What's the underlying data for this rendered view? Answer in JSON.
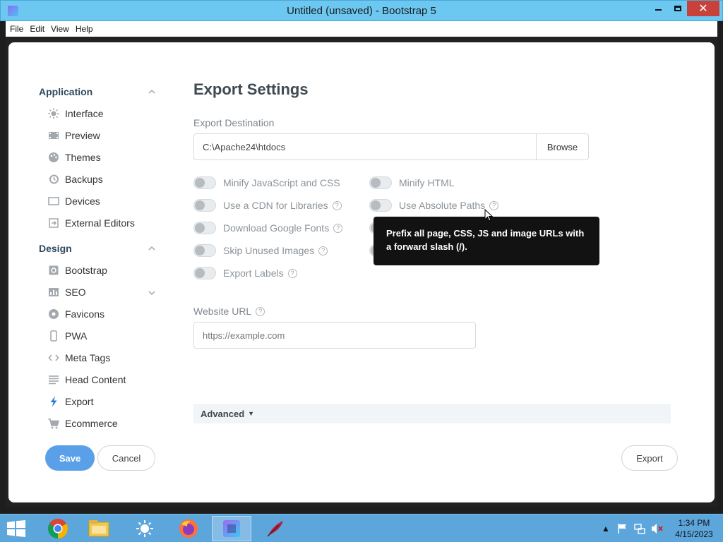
{
  "window": {
    "title": "Untitled (unsaved) - Bootstrap 5"
  },
  "menu": [
    "File",
    "Edit",
    "View",
    "Help"
  ],
  "sidebar": {
    "application": {
      "label": "Application",
      "items": [
        {
          "label": "Interface",
          "icon": "sun-icon"
        },
        {
          "label": "Preview",
          "icon": "film-icon"
        },
        {
          "label": "Themes",
          "icon": "palette-icon"
        },
        {
          "label": "Backups",
          "icon": "history-icon"
        },
        {
          "label": "Devices",
          "icon": "monitor-icon"
        },
        {
          "label": "External Editors",
          "icon": "external-icon"
        }
      ]
    },
    "design": {
      "label": "Design",
      "items": [
        {
          "label": "Bootstrap",
          "icon": "gear-icon"
        },
        {
          "label": "SEO",
          "icon": "chart-icon"
        },
        {
          "label": "Favicons",
          "icon": "circle-icon"
        },
        {
          "label": "PWA",
          "icon": "phone-icon"
        },
        {
          "label": "Meta Tags",
          "icon": "code-icon"
        },
        {
          "label": "Head Content",
          "icon": "lines-icon"
        },
        {
          "label": "Export",
          "icon": "bolt-icon"
        },
        {
          "label": "Ecommerce",
          "icon": "cart-icon"
        }
      ]
    }
  },
  "buttons": {
    "save": "Save",
    "cancel": "Cancel",
    "export": "Export"
  },
  "main": {
    "title": "Export Settings",
    "export_destination_label": "Export Destination",
    "export_destination_value": "C:\\Apache24\\htdocs",
    "browse": "Browse",
    "toggles_left": [
      {
        "label": "Minify JavaScript and CSS",
        "help": false
      },
      {
        "label": "Use a CDN for Libraries",
        "help": true
      },
      {
        "label": "Download Google Fonts",
        "help": true
      },
      {
        "label": "Skip Unused Images",
        "help": true
      },
      {
        "label": "Export Labels",
        "help": true
      }
    ],
    "toggles_right": [
      {
        "label": "Minify HTML",
        "help": false
      },
      {
        "label": "Use Absolute Paths",
        "help": true
      }
    ],
    "website_url_label": "Website URL",
    "website_url_placeholder": "https://example.com",
    "advanced": "Advanced",
    "tooltip": "Prefix all page, CSS, JS and image URLs with a forward slash (/)."
  },
  "taskbar": {
    "time": "1:34 PM",
    "date": "4/15/2023"
  },
  "colors": {
    "accent": "#5aa0e8",
    "titlebar": "#6cc8f0",
    "taskbar": "#5ca6dc",
    "close": "#c8413a"
  }
}
